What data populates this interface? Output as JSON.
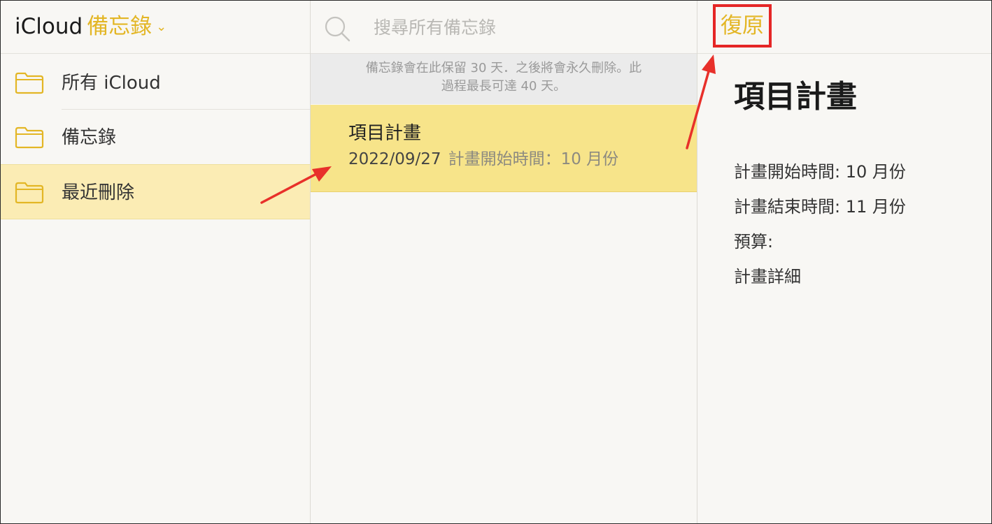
{
  "sidebar": {
    "title_prefix": "iCloud",
    "title_app": "備忘錄",
    "title_chevron": "⌄",
    "folders": [
      {
        "label": "所有 iCloud",
        "icon": "folder-icon"
      },
      {
        "label": "備忘錄",
        "icon": "folder-icon"
      },
      {
        "label": "最近刪除",
        "icon": "folder-icon",
        "selected": true
      }
    ]
  },
  "search": {
    "placeholder": "搜尋所有備忘錄",
    "icon": "search-icon"
  },
  "notice": {
    "line1": "備忘錄會在此保留 30 天．之後將會永久刪除。此",
    "line2": "過程最長可達 40 天。"
  },
  "note_list": [
    {
      "title": "項目計畫",
      "date": "2022/09/27",
      "snippet": "計畫開始時間：10 月份",
      "selected": true
    }
  ],
  "detail": {
    "restore_label": "復原",
    "title": "項目計畫",
    "lines": [
      "計畫開始時間:  10 月份",
      "計畫結束時間:  11 月份",
      "預算:",
      "計畫詳細"
    ]
  },
  "colors": {
    "accent": "#e3b625",
    "selected_folder_bg": "#fbecb4",
    "selected_note_bg": "#f7e48a",
    "highlight_box": "#e52626",
    "arrow": "#e8302a"
  }
}
